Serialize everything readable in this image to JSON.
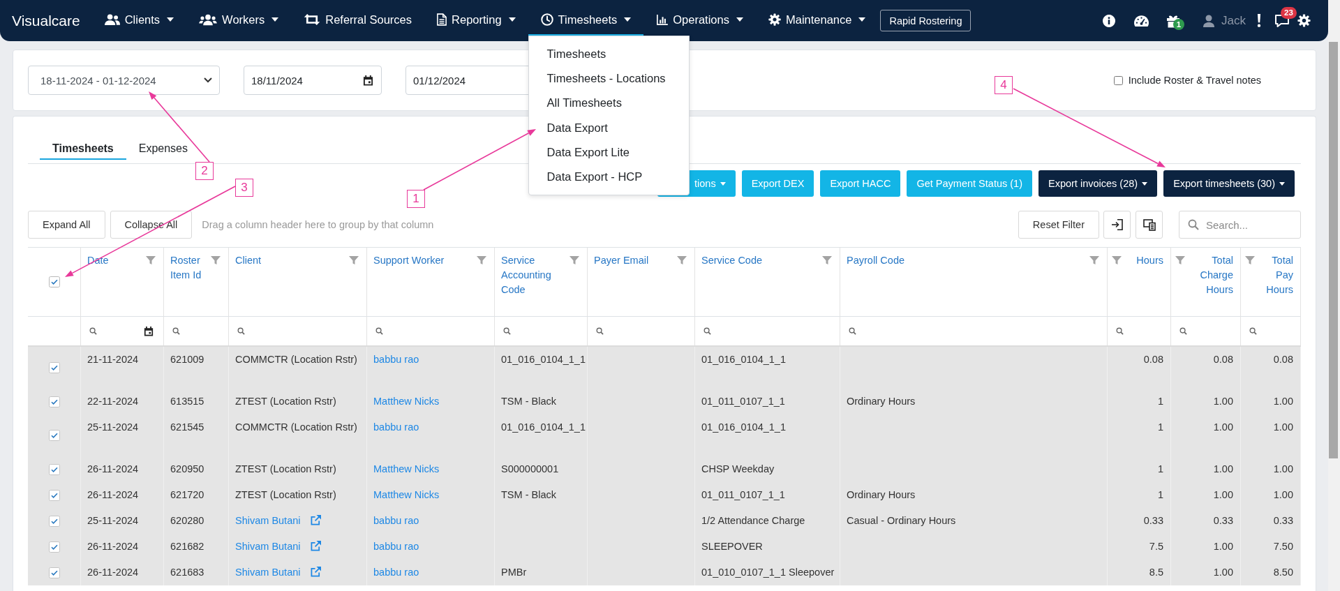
{
  "navbar": {
    "brand": "Visualcare",
    "items": [
      {
        "label": "Clients",
        "dropdown": true,
        "selected": false
      },
      {
        "label": "Workers",
        "dropdown": true,
        "selected": false
      },
      {
        "label": "Referral Sources",
        "dropdown": false,
        "selected": false
      },
      {
        "label": "Reporting",
        "dropdown": true,
        "selected": false
      },
      {
        "label": "Timesheets",
        "dropdown": true,
        "selected": true,
        "menu": [
          "Timesheets",
          "Timesheets - Locations",
          "All Timesheets",
          "Data Export",
          "Data Export Lite",
          "Data Export - HCP"
        ]
      },
      {
        "label": "Operations",
        "dropdown": true,
        "selected": false
      },
      {
        "label": "Maintenance",
        "dropdown": true,
        "selected": false
      }
    ],
    "rapid_button": "Rapid Rostering",
    "gift_badge": "1",
    "user_name": "Jack",
    "messages_badge": "23"
  },
  "filters": {
    "period": "18-11-2024 - 01-12-2024",
    "dates": [
      {
        "value": "18/11/2024",
        "picker": true
      },
      {
        "value": "01/12/2024",
        "picker": false
      }
    ],
    "include_notes": {
      "label": "Include Roster & Travel notes",
      "checked": false
    }
  },
  "tabs": [
    {
      "label": "Timesheets",
      "selected": true
    },
    {
      "label": "Expenses",
      "selected": false
    }
  ],
  "actions": [
    {
      "label": "tions",
      "kind": "info",
      "dropdown": true
    },
    {
      "label": "Export DEX",
      "kind": "info",
      "dropdown": false
    },
    {
      "label": "Export HACC",
      "kind": "info",
      "dropdown": false
    },
    {
      "label": "Get Payment Status (1)",
      "kind": "info",
      "dropdown": false
    },
    {
      "label": "Export invoices (28)",
      "kind": "dark",
      "dropdown": true
    },
    {
      "label": "Export timesheets (30)",
      "kind": "dark",
      "dropdown": true
    }
  ],
  "grid_toolbar": {
    "buttons": [
      "Expand All",
      "Collapse All"
    ],
    "group_hint": "Drag a column header here to group by that column",
    "reset": "Reset Filter",
    "search": {
      "placeholder": "Search..."
    }
  },
  "table": {
    "all_selected": true,
    "columns": [
      {
        "label": "Date",
        "kind": "date"
      },
      {
        "label": "Roster Item Id",
        "kind": "text"
      },
      {
        "label": "Client",
        "kind": "client"
      },
      {
        "label": "Support Worker",
        "kind": "link"
      },
      {
        "label": "Service Accounting Code",
        "kind": "text"
      },
      {
        "label": "Payer Email",
        "kind": "text"
      },
      {
        "label": "Service Code",
        "kind": "text"
      },
      {
        "label": "Payroll Code",
        "kind": "text"
      },
      {
        "label": "Hours",
        "kind": "number"
      },
      {
        "label": "Total Charge Hours",
        "kind": "number"
      },
      {
        "label": "Total Pay Hours",
        "kind": "number"
      }
    ],
    "rows": [
      {
        "selected": true,
        "linked_client": false,
        "cells": [
          "21-11-2024",
          "621009",
          "COMMCTR (Location Rstr)",
          "babbu rao",
          "01_016_0104_1_1",
          null,
          "01_016_0104_1_1",
          null,
          "0.08",
          "0.08",
          "0.08"
        ]
      },
      {
        "selected": true,
        "linked_client": false,
        "cells": [
          "22-11-2024",
          "613515",
          "ZTEST (Location Rstr)",
          "Matthew Nicks",
          "TSM - Black",
          null,
          "01_011_0107_1_1",
          "Ordinary Hours",
          "1",
          "1.00",
          "1.00"
        ]
      },
      {
        "selected": true,
        "linked_client": false,
        "cells": [
          "25-11-2024",
          "621545",
          "COMMCTR (Location Rstr)",
          "babbu rao",
          "01_016_0104_1_1",
          null,
          "01_016_0104_1_1",
          null,
          "1",
          "1.00",
          "1.00"
        ]
      },
      {
        "selected": true,
        "linked_client": false,
        "cells": [
          "26-11-2024",
          "620950",
          "ZTEST (Location Rstr)",
          "Matthew Nicks",
          "S000000001",
          null,
          "CHSP Weekday",
          null,
          "1",
          "1.00",
          "1.00"
        ]
      },
      {
        "selected": true,
        "linked_client": false,
        "cells": [
          "26-11-2024",
          "621720",
          "ZTEST (Location Rstr)",
          "Matthew Nicks",
          "TSM - Black",
          null,
          "01_011_0107_1_1",
          "Ordinary Hours",
          "1",
          "1.00",
          "1.00"
        ]
      },
      {
        "selected": true,
        "linked_client": true,
        "cells": [
          "25-11-2024",
          "620280",
          "Shivam Butani",
          "babbu rao",
          null,
          null,
          "1/2 Attendance Charge",
          "Casual - Ordinary Hours",
          "0.33",
          "0.33",
          "0.33"
        ]
      },
      {
        "selected": true,
        "linked_client": true,
        "cells": [
          "26-11-2024",
          "621682",
          "Shivam Butani",
          "babbu rao",
          null,
          null,
          "SLEEPOVER",
          null,
          "7.5",
          "1.00",
          "7.50"
        ]
      },
      {
        "selected": true,
        "linked_client": true,
        "cells": [
          "26-11-2024",
          "621683",
          "Shivam Butani",
          "babbu rao",
          "PMBr",
          null,
          "01_010_0107_1_1 Sleepover",
          null,
          "8.5",
          "1.00",
          "8.50"
        ]
      }
    ]
  },
  "callouts": [
    {
      "label": "1"
    },
    {
      "label": "2"
    },
    {
      "label": "3"
    },
    {
      "label": "4"
    }
  ]
}
